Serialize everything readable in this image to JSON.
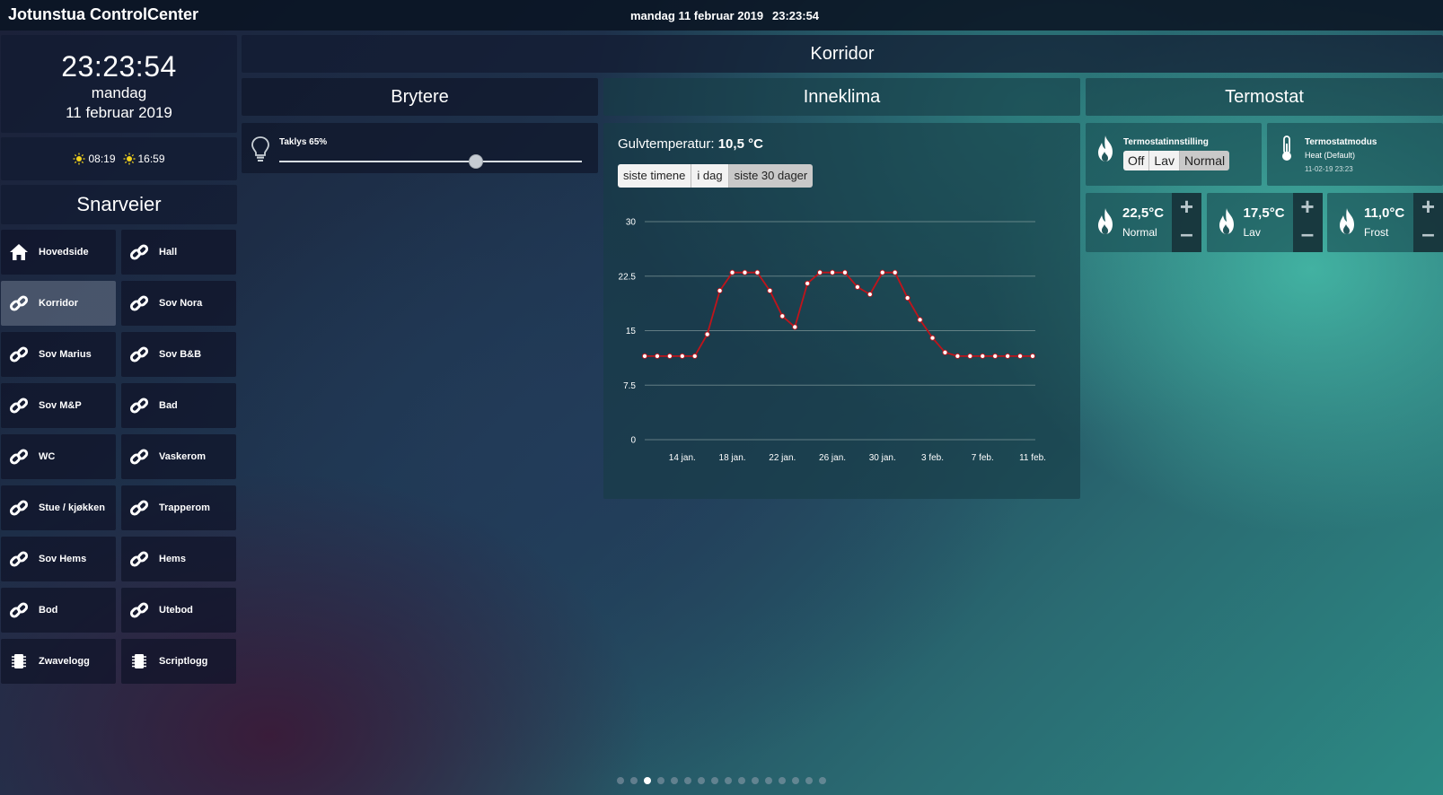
{
  "app": {
    "title": "Jotunstua ControlCenter",
    "date": "mandag 11 februar 2019",
    "time": "23:23:54"
  },
  "clock": {
    "time": "23:23:54",
    "weekday": "mandag",
    "date": "11 februar 2019"
  },
  "sun": {
    "sunrise": "08:19",
    "sunset": "16:59"
  },
  "shortcuts": {
    "title": "Snarveier",
    "items": [
      {
        "label": "Hovedside",
        "icon": "home-icon"
      },
      {
        "label": "Hall",
        "icon": "link-icon"
      },
      {
        "label": "Korridor",
        "icon": "link-icon",
        "active": true
      },
      {
        "label": "Sov Nora",
        "icon": "link-icon"
      },
      {
        "label": "Sov Marius",
        "icon": "link-icon"
      },
      {
        "label": "Sov B&B",
        "icon": "link-icon"
      },
      {
        "label": "Sov M&P",
        "icon": "link-icon"
      },
      {
        "label": "Bad",
        "icon": "link-icon"
      },
      {
        "label": "WC",
        "icon": "link-icon"
      },
      {
        "label": "Vaskerom",
        "icon": "link-icon"
      },
      {
        "label": "Stue / kjøkken",
        "icon": "link-icon"
      },
      {
        "label": "Trapperom",
        "icon": "link-icon"
      },
      {
        "label": "Sov Hems",
        "icon": "link-icon"
      },
      {
        "label": "Hems",
        "icon": "link-icon"
      },
      {
        "label": "Bod",
        "icon": "link-icon"
      },
      {
        "label": "Utebod",
        "icon": "link-icon"
      },
      {
        "label": "Zwavelogg",
        "icon": "chip-icon"
      },
      {
        "label": "Scriptlogg",
        "icon": "chip-icon"
      }
    ]
  },
  "room": {
    "title": "Korridor"
  },
  "switches": {
    "title": "Brytere",
    "taklys": {
      "label": "Taklys 65%",
      "level": 65
    }
  },
  "climate": {
    "title": "Inneklima",
    "floor_label": "Gulvtemperatur:",
    "floor_value": "10,5 °C",
    "ranges": [
      "siste timene",
      "i dag",
      "siste 30 dager"
    ],
    "selected_range": "siste 30 dager"
  },
  "thermostat": {
    "title": "Termostat",
    "setting": {
      "title": "Termostatinnstilling",
      "options": [
        "Off",
        "Lav",
        "Normal"
      ],
      "selected": "Normal"
    },
    "mode": {
      "title": "Termostatmodus",
      "value": "Heat (Default)",
      "timestamp": "11-02-19 23:23"
    },
    "setpoints": [
      {
        "value": "22,5°C",
        "name": "Normal"
      },
      {
        "value": "17,5°C",
        "name": "Lav"
      },
      {
        "value": "11,0°C",
        "name": "Frost"
      }
    ],
    "plus": "+",
    "minus": "–"
  },
  "pager": {
    "count": 16,
    "active": 2
  },
  "colors": {
    "line": "#c0141b",
    "accent_teal": "#2c8a84",
    "grid": "#9fb3b0"
  },
  "chart_data": {
    "type": "line",
    "title": "",
    "xlabel": "",
    "ylabel": "",
    "ylim": [
      0,
      30
    ],
    "yticks": [
      "0",
      "7.5",
      "15",
      "22.5",
      "30"
    ],
    "xtick_labels": [
      "14 jan.",
      "18 jan.",
      "22 jan.",
      "26 jan.",
      "30 jan.",
      "3 feb.",
      "7 feb.",
      "11 feb."
    ],
    "x_start": "11 jan.",
    "x": [
      "11 jan.",
      "12 jan.",
      "13 jan.",
      "14 jan.",
      "15 jan.",
      "16 jan.",
      "17 jan.",
      "18 jan.",
      "19 jan.",
      "20 jan.",
      "21 jan.",
      "22 jan.",
      "23 jan.",
      "24 jan.",
      "25 jan.",
      "26 jan.",
      "27 jan.",
      "28 jan.",
      "29 jan.",
      "30 jan.",
      "31 jan.",
      "1 feb.",
      "2 feb.",
      "3 feb.",
      "4 feb.",
      "5 feb.",
      "6 feb.",
      "7 feb.",
      "8 feb.",
      "9 feb.",
      "10 feb.",
      "11 feb."
    ],
    "values": [
      11.5,
      11.5,
      11.5,
      11.5,
      11.5,
      14.5,
      20.5,
      23,
      23,
      23,
      20.5,
      17,
      15.5,
      21.5,
      23,
      23,
      23,
      21,
      20,
      23,
      23,
      19.5,
      16.5,
      14,
      12,
      11.5,
      11.5,
      11.5,
      11.5,
      11.5,
      11.5,
      11.5
    ],
    "grid": true
  }
}
